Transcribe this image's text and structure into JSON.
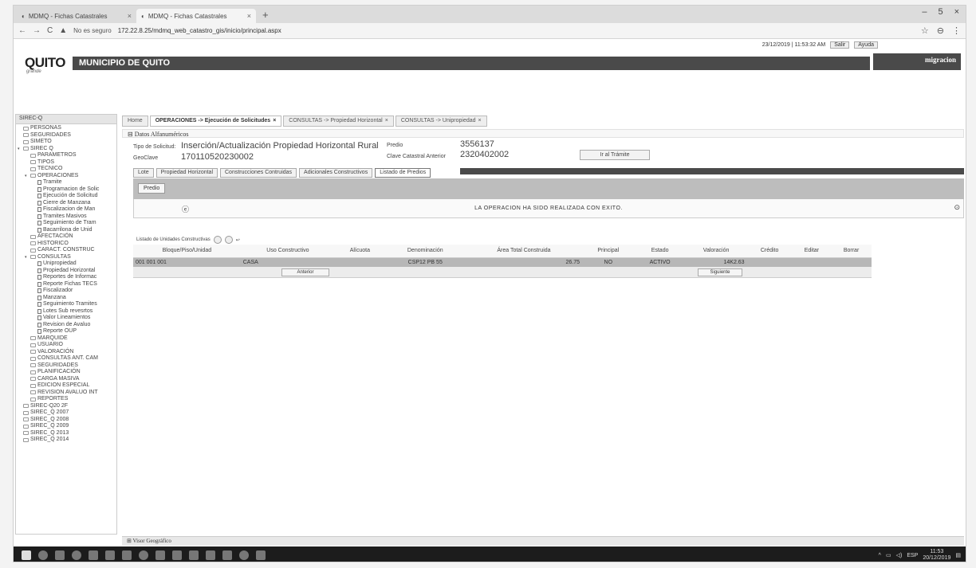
{
  "browser": {
    "tabs": [
      {
        "label": "MDMQ - Fichas Catastrales",
        "active": false
      },
      {
        "label": "MDMQ - Fichas Catastrales",
        "active": true
      }
    ],
    "new_tab": "+",
    "window_controls": {
      "minimize": "–",
      "maximize": "5",
      "close": "×"
    },
    "security": "No es seguro",
    "url": "172.22.8.25/mdmq_web_catastro_gis/inicio/principal.aspx",
    "star": "☆",
    "profile": "⊖",
    "menu": "⋮"
  },
  "app": {
    "datetime": "23/12/2019 | 11:53:32 AM",
    "exit_label": "Salir",
    "help_label": "Ayuda",
    "logo": "QUITO",
    "logo_sub": "grande",
    "title": "MUNICIPIO DE QUITO",
    "user": "migracion"
  },
  "sidebar": {
    "header": "SIREC-Q",
    "items": [
      {
        "label": "PERSONAS",
        "depth": 0,
        "type": "folder",
        "arrow": ""
      },
      {
        "label": "SEGURIDADES",
        "depth": 0,
        "type": "folder",
        "arrow": ""
      },
      {
        "label": "SIMETO",
        "depth": 0,
        "type": "folder",
        "arrow": ""
      },
      {
        "label": "SIREC Q",
        "depth": 0,
        "type": "folder",
        "arrow": "▾"
      },
      {
        "label": "PARAMETROS",
        "depth": 1,
        "type": "folder",
        "arrow": ""
      },
      {
        "label": "TIPOS",
        "depth": 1,
        "type": "folder",
        "arrow": ""
      },
      {
        "label": "TECNICO",
        "depth": 1,
        "type": "folder",
        "arrow": ""
      },
      {
        "label": "OPERACIONES",
        "depth": 1,
        "type": "folder",
        "arrow": "▾"
      },
      {
        "label": "Tramite",
        "depth": 2,
        "type": "file",
        "arrow": ""
      },
      {
        "label": "Programacion de Solic",
        "depth": 2,
        "type": "file",
        "arrow": ""
      },
      {
        "label": "Ejecución de Solicitud",
        "depth": 2,
        "type": "file",
        "arrow": ""
      },
      {
        "label": "Cierre de Manzana",
        "depth": 2,
        "type": "file",
        "arrow": ""
      },
      {
        "label": "Fiscalizacion de Man",
        "depth": 2,
        "type": "file",
        "arrow": ""
      },
      {
        "label": "Tramites Masivos",
        "depth": 2,
        "type": "file",
        "arrow": ""
      },
      {
        "label": "Seguimiento de Tram",
        "depth": 2,
        "type": "file",
        "arrow": ""
      },
      {
        "label": "Bacarrilona de Unid",
        "depth": 2,
        "type": "file",
        "arrow": ""
      },
      {
        "label": "AFECTACIÓN",
        "depth": 1,
        "type": "folder",
        "arrow": ""
      },
      {
        "label": "HISTORICO",
        "depth": 1,
        "type": "folder",
        "arrow": ""
      },
      {
        "label": "CARACT. CONSTRUC",
        "depth": 1,
        "type": "folder",
        "arrow": ""
      },
      {
        "label": "CONSULTAS",
        "depth": 1,
        "type": "folder",
        "arrow": "▾"
      },
      {
        "label": "Unipropiedad",
        "depth": 2,
        "type": "file",
        "arrow": ""
      },
      {
        "label": "Propiedad Horizontal",
        "depth": 2,
        "type": "file",
        "arrow": ""
      },
      {
        "label": "Reportes de Informac",
        "depth": 2,
        "type": "file",
        "arrow": ""
      },
      {
        "label": "Reporte Fichas TECS",
        "depth": 2,
        "type": "file",
        "arrow": ""
      },
      {
        "label": "Fiscalizador",
        "depth": 2,
        "type": "file",
        "arrow": ""
      },
      {
        "label": "Manzana",
        "depth": 2,
        "type": "file",
        "arrow": ""
      },
      {
        "label": "Seguimiento Tramites",
        "depth": 2,
        "type": "file",
        "arrow": ""
      },
      {
        "label": "Lotes Sub revesrtos",
        "depth": 2,
        "type": "file",
        "arrow": ""
      },
      {
        "label": "Valor Lineamientos",
        "depth": 2,
        "type": "file",
        "arrow": ""
      },
      {
        "label": "Revision de Avaluo",
        "depth": 2,
        "type": "file",
        "arrow": ""
      },
      {
        "label": "Reporte OUP",
        "depth": 2,
        "type": "file",
        "arrow": ""
      },
      {
        "label": "MARQUIDE",
        "depth": 1,
        "type": "folder",
        "arrow": ""
      },
      {
        "label": "USUARIO",
        "depth": 1,
        "type": "folder",
        "arrow": ""
      },
      {
        "label": "VALORACIÓN",
        "depth": 1,
        "type": "folder",
        "arrow": ""
      },
      {
        "label": "CONSULTAS ANT. CAM",
        "depth": 1,
        "type": "folder",
        "arrow": ""
      },
      {
        "label": "SEGURIDADES",
        "depth": 1,
        "type": "folder",
        "arrow": ""
      },
      {
        "label": "PLANIFICACIÓN",
        "depth": 1,
        "type": "folder",
        "arrow": ""
      },
      {
        "label": "CARGA MASIVA",
        "depth": 1,
        "type": "folder",
        "arrow": ""
      },
      {
        "label": "EDICION ESPECIAL",
        "depth": 1,
        "type": "folder",
        "arrow": ""
      },
      {
        "label": "REVISION AVALUO INT",
        "depth": 1,
        "type": "folder",
        "arrow": ""
      },
      {
        "label": "REPORTES",
        "depth": 1,
        "type": "folder",
        "arrow": ""
      },
      {
        "label": "SIREC-Q20 2F",
        "depth": 0,
        "type": "folder",
        "arrow": ""
      },
      {
        "label": "SIREC_Q 2007",
        "depth": 0,
        "type": "folder",
        "arrow": ""
      },
      {
        "label": "SIREC_Q 2008",
        "depth": 0,
        "type": "folder",
        "arrow": ""
      },
      {
        "label": "SIREC_Q 2009",
        "depth": 0,
        "type": "folder",
        "arrow": ""
      },
      {
        "label": "SIREC_Q 2013",
        "depth": 0,
        "type": "folder",
        "arrow": ""
      },
      {
        "label": "SIREC_Q 2014",
        "depth": 0,
        "type": "folder",
        "arrow": ""
      }
    ]
  },
  "main": {
    "tabs": [
      {
        "label": "Home",
        "active": false,
        "close": ""
      },
      {
        "label": "OPERACIONES -> Ejecución de Solicitudes",
        "active": true,
        "close": "×"
      },
      {
        "label": "CONSULTAS -> Propiedad Horizontal",
        "active": false,
        "close": "×"
      },
      {
        "label": "CONSULTAS -> Unipropiedad",
        "active": false,
        "close": "×"
      }
    ],
    "section": "Datos Alfanuméricos",
    "form": {
      "tipo_label": "Tipo de Solicitud:",
      "tipo_value": "Inserción/Actualización Propiedad Horizontal Rural",
      "geoclave_label": "GeoClave",
      "geoclave_value": "170110520230002",
      "predio_label": "Predio",
      "predio_value": "3556137",
      "clave_label": "Clave Catastral Anterior",
      "clave_value": "2320402002",
      "go_button": "Ir al Trámite"
    },
    "lot_tabs": [
      {
        "label": "Lote",
        "active": false
      },
      {
        "label": "Propiedad Horizontal",
        "active": false
      },
      {
        "label": "Construcciones Contruidas",
        "active": false
      },
      {
        "label": "Adicionales Constructivos",
        "active": false
      },
      {
        "label": "Listado de Predios",
        "active": true
      }
    ],
    "predio_button": "Predio",
    "message": "LA OPERACION HA SIDO REALIZADA CON EXITO.",
    "listing": {
      "title": "Listado de Unidades Constructivas",
      "columns": [
        "Bloque/Piso/Unidad",
        "Uso Constructivo",
        "Alícuota",
        "Denominación",
        "Área Total Construida",
        "Principal",
        "Estado",
        "Valoración",
        "Crédito",
        "Editar",
        "Borrar"
      ],
      "rows": [
        [
          "001 001 001",
          "CASA",
          "",
          "CSP12 PB 55",
          "26.75",
          "NO",
          "ACTIVO",
          "14K2.63",
          "",
          "",
          ""
        ]
      ],
      "prev_button": "Anterior",
      "next_button": "Siguiente"
    }
  },
  "visor": "Visor Geográfico",
  "taskbar": {
    "lang": "ESP",
    "time": "11:53",
    "date": "20/12/2019"
  }
}
